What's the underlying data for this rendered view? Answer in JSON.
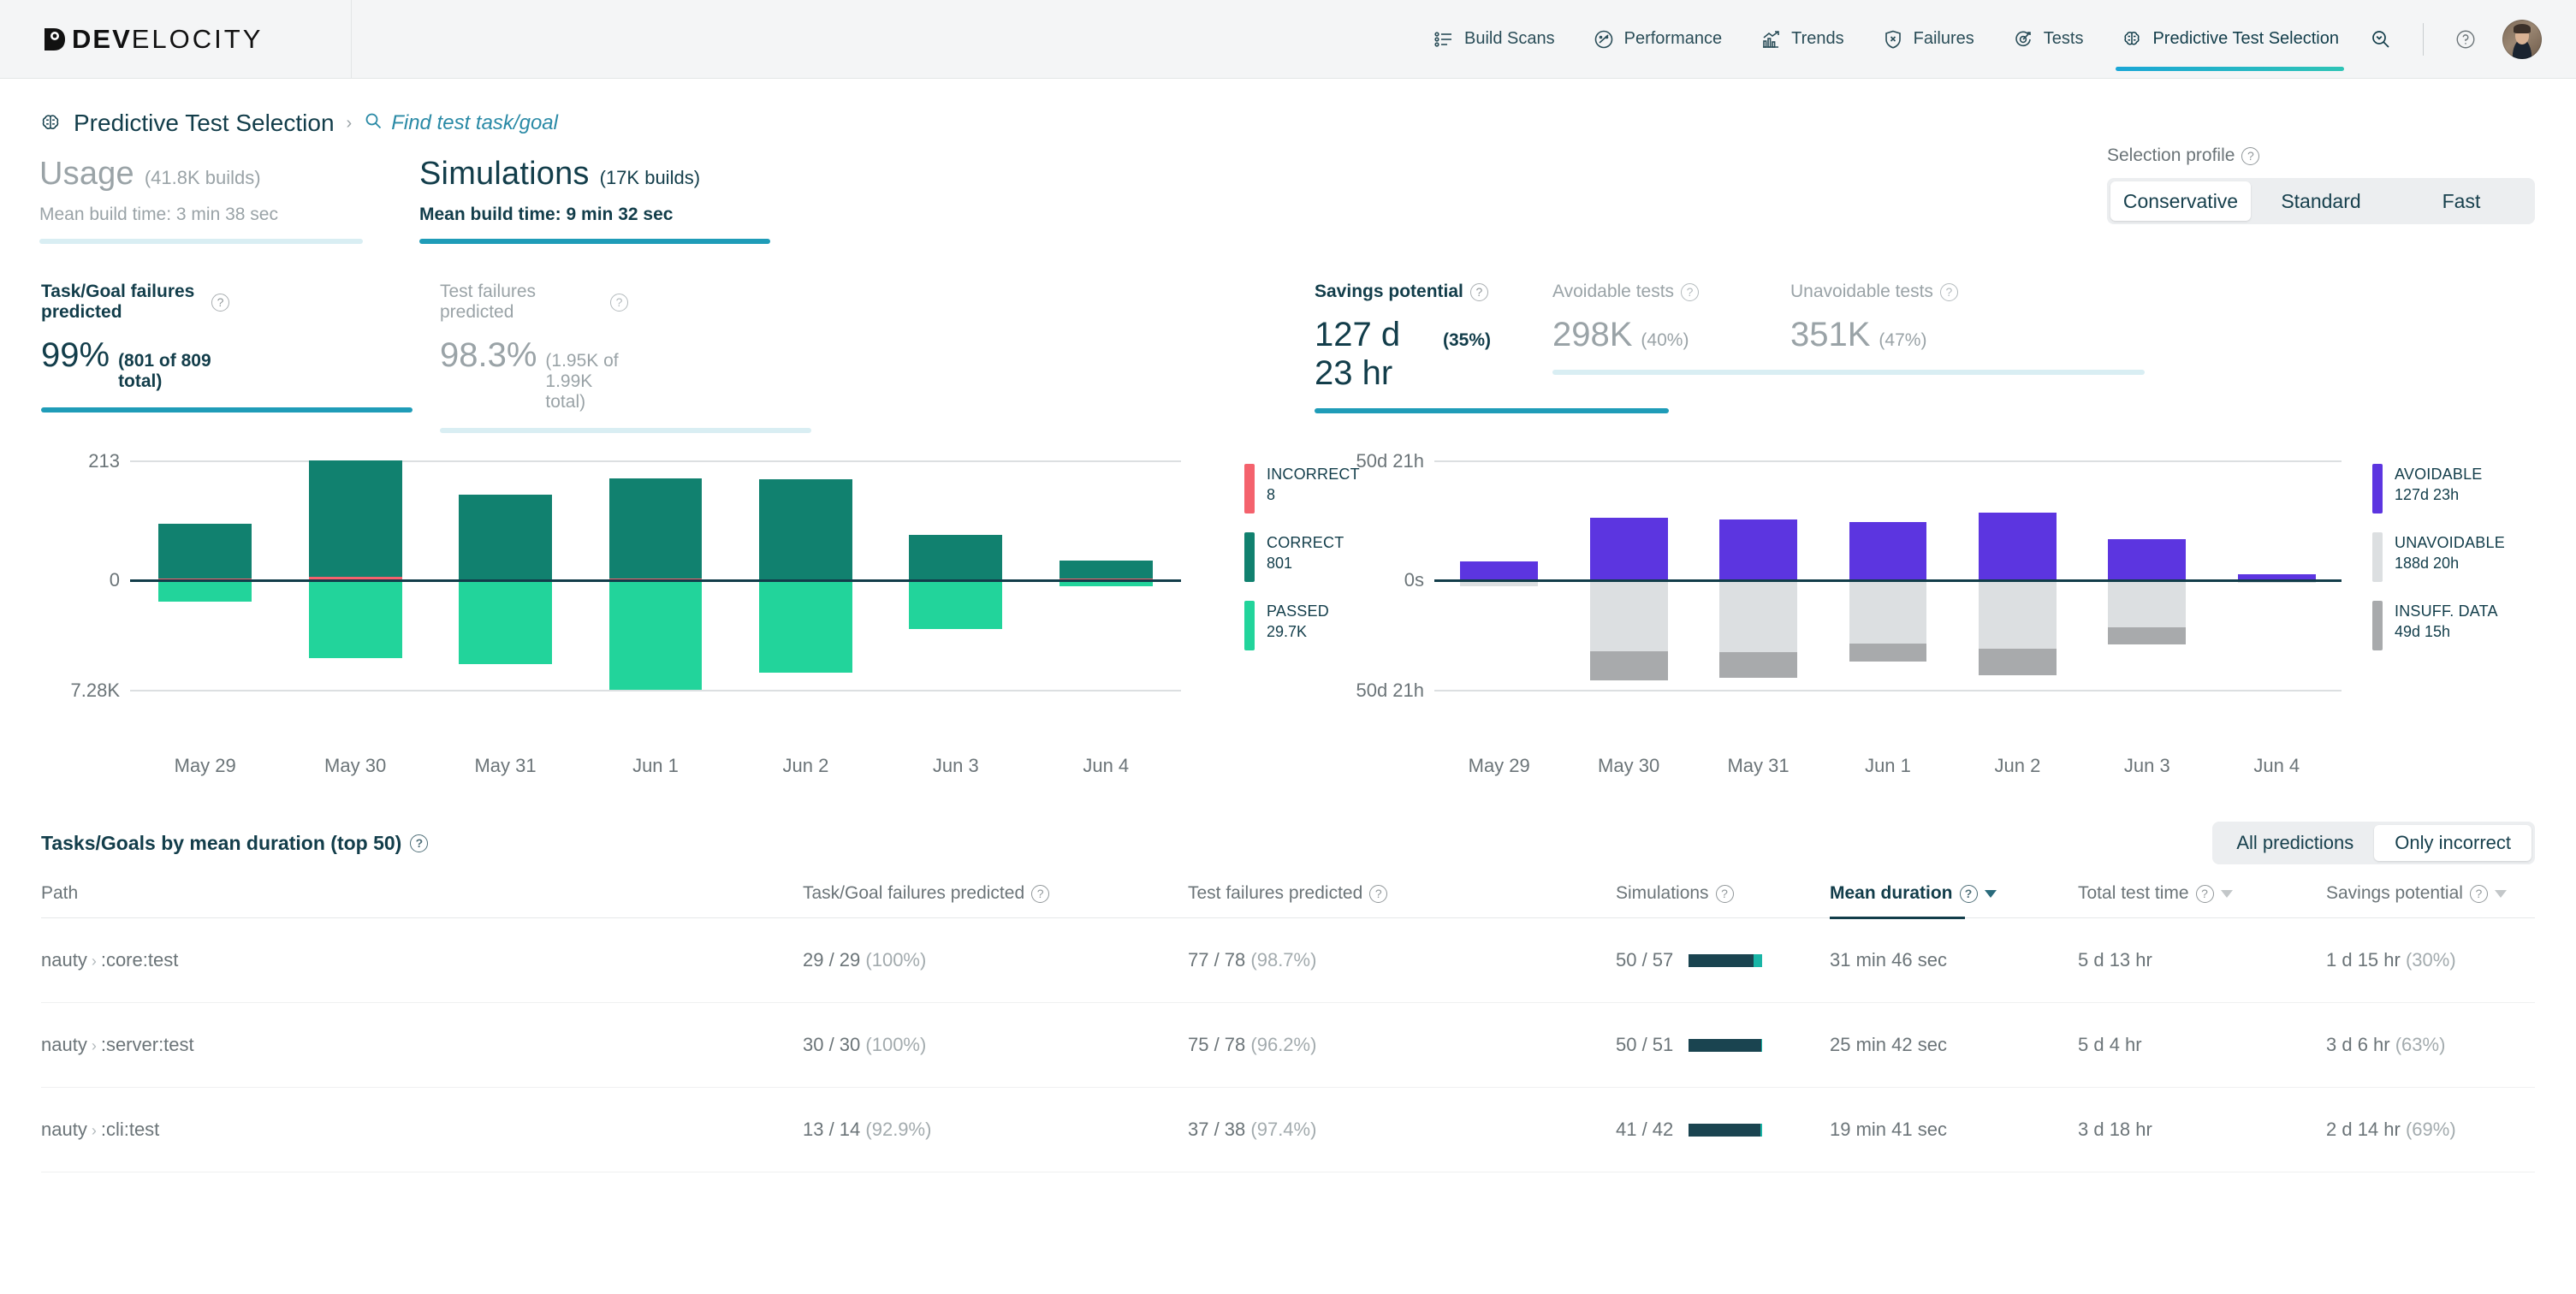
{
  "brand": {
    "bold": "DEV",
    "light": "ELOCITY"
  },
  "nav": {
    "items": [
      {
        "label": "Build Scans",
        "icon": "list-icon",
        "active": false
      },
      {
        "label": "Performance",
        "icon": "speedometer-icon",
        "active": false
      },
      {
        "label": "Trends",
        "icon": "trend-chart-icon",
        "active": false
      },
      {
        "label": "Failures",
        "icon": "shield-x-icon",
        "active": false
      },
      {
        "label": "Tests",
        "icon": "test-target-icon",
        "active": false
      },
      {
        "label": "Predictive Test Selection",
        "icon": "brain-icon",
        "active": true
      }
    ],
    "search_icon": "search-chevron-icon",
    "help_icon": "help-circle-icon",
    "avatar": "user-avatar"
  },
  "breadcrumb": {
    "icon": "brain-icon",
    "title": "Predictive Test Selection",
    "chevron": "›",
    "search_icon": "search-icon",
    "link": "Find test task/goal"
  },
  "headline_tabs": [
    {
      "title": "Usage",
      "count": "(41.8K builds)",
      "sub_label": "Mean build time:",
      "sub_value": "3 min 38 sec",
      "active": false
    },
    {
      "title": "Simulations",
      "count": "(17K builds)",
      "sub_label": "Mean build time:",
      "sub_value": "9 min 32 sec",
      "active": true
    }
  ],
  "selection_profile": {
    "label": "Selection profile",
    "help": "?",
    "options": [
      "Conservative",
      "Standard",
      "Fast"
    ],
    "selected": "Conservative"
  },
  "kpis_left": [
    {
      "label": "Task/Goal failures predicted",
      "value": "99%",
      "paren": "(801 of 809 total)",
      "active": true
    },
    {
      "label": "Test failures predicted",
      "value": "98.3%",
      "paren": "(1.95K of 1.99K total)",
      "active": false
    }
  ],
  "kpis_right": [
    {
      "label": "Savings potential",
      "value": "127 d 23 hr",
      "paren": "(35%)",
      "active": true
    },
    {
      "label": "Avoidable tests",
      "value": "298K",
      "paren": "(40%)",
      "active": false
    },
    {
      "label": "Unavoidable tests",
      "value": "351K",
      "paren": "(47%)",
      "active": false
    }
  ],
  "chart_data": [
    {
      "type": "bar",
      "id": "predictions-chart",
      "title": "",
      "xlabel": "",
      "ylabel": "",
      "categories": [
        "May 29",
        "May 30",
        "May 31",
        "Jun 1",
        "Jun 2",
        "Jun 3",
        "Jun 4"
      ],
      "y_ticks": [
        "213",
        "0",
        "7.28K"
      ],
      "ylim_top": 213,
      "ylim_bottom": -7280,
      "grid": true,
      "legend_position": "right",
      "series": [
        {
          "name": "INCORRECT",
          "total": "8",
          "color": "#f4626d",
          "values": [
            2,
            4,
            0,
            1,
            0,
            0,
            1
          ]
        },
        {
          "name": "CORRECT",
          "total": "801",
          "color": "#11816f",
          "values": [
            98,
            209,
            151,
            180,
            180,
            80,
            33
          ]
        },
        {
          "name": "PASSED",
          "total": "29.7K",
          "color": "#22d49b",
          "values": [
            -1450,
            -5200,
            -5600,
            -7280,
            -6150,
            -3250,
            -450
          ]
        }
      ]
    },
    {
      "type": "bar",
      "id": "savings-chart",
      "title": "",
      "xlabel": "",
      "ylabel": "",
      "categories": [
        "May 29",
        "May 30",
        "May 31",
        "Jun 1",
        "Jun 2",
        "Jun 3",
        "Jun 4"
      ],
      "y_ticks": [
        "50d 21h",
        "0s",
        "50d 21h"
      ],
      "grid": true,
      "legend_position": "right",
      "series": [
        {
          "name": "AVOIDABLE",
          "total": "127d 23h",
          "color": "#5c35e0",
          "values": [
            7.8,
            26.5,
            25.8,
            24.5,
            28.5,
            17.2,
            2.2
          ]
        },
        {
          "name": "UNAVOIDABLE",
          "total": "188d 20h",
          "color": "#dcdfe1",
          "values": [
            -3.0,
            -33.0,
            -33.5,
            -29.5,
            -32.0,
            -22.0,
            -1.5
          ]
        },
        {
          "name": "INSUFF. DATA",
          "total": "49d 15h",
          "color": "#a8aaac",
          "values": [
            0,
            -13.5,
            -12.0,
            -8.5,
            -12.0,
            -8.0,
            0
          ]
        }
      ]
    }
  ],
  "table": {
    "title": "Tasks/Goals by mean duration (top 50)",
    "title_help": "?",
    "filter": {
      "options": [
        "All predictions",
        "Only incorrect"
      ],
      "selected": "Only incorrect"
    },
    "columns": [
      {
        "label": "Path",
        "help": false,
        "sortable": false,
        "sorted": false
      },
      {
        "label": "Task/Goal failures predicted",
        "help": true,
        "sortable": false,
        "sorted": false
      },
      {
        "label": "Test failures predicted",
        "help": true,
        "sortable": false,
        "sorted": false
      },
      {
        "label": "Simulations",
        "help": true,
        "sortable": false,
        "sorted": false
      },
      {
        "label": "Mean duration",
        "help": true,
        "sortable": true,
        "sorted": true
      },
      {
        "label": "Total test time",
        "help": true,
        "sortable": true,
        "sorted": false
      },
      {
        "label": "Savings potential",
        "help": true,
        "sortable": true,
        "sorted": false
      }
    ],
    "rows": [
      {
        "project": "nauty",
        "task": ":core:test",
        "taskgoal_failures": "29 / 29",
        "taskgoal_pct": "(100%)",
        "test_failures": "77 / 78",
        "test_pct": "(98.7%)",
        "simulations": "50 / 57",
        "sim_ratio": 0.877,
        "mean_duration": "31 min 46 sec",
        "total_test_time": "5 d 13 hr",
        "savings": "1 d 15 hr",
        "savings_pct": "(30%)"
      },
      {
        "project": "nauty",
        "task": ":server:test",
        "taskgoal_failures": "30 / 30",
        "taskgoal_pct": "(100%)",
        "test_failures": "75 / 78",
        "test_pct": "(96.2%)",
        "simulations": "50 / 51",
        "sim_ratio": 0.98,
        "mean_duration": "25 min 42 sec",
        "total_test_time": "5 d 4 hr",
        "savings": "3 d 6 hr",
        "savings_pct": "(63%)"
      },
      {
        "project": "nauty",
        "task": ":cli:test",
        "taskgoal_failures": "13 / 14",
        "taskgoal_pct": "(92.9%)",
        "test_failures": "37 / 38",
        "test_pct": "(97.4%)",
        "simulations": "41 / 42",
        "sim_ratio": 0.976,
        "mean_duration": "19 min 41 sec",
        "total_test_time": "3 d 18 hr",
        "savings": "2 d 14 hr",
        "savings_pct": "(69%)"
      }
    ]
  },
  "colors": {
    "accent_teal": "#1f9cb8",
    "dark": "#123d4a",
    "incorrect": "#f4626d",
    "correct": "#11816f",
    "passed": "#22d49b",
    "avoidable": "#5c35e0",
    "unavoidable": "#dcdfe1",
    "insufficient": "#a8aaac"
  }
}
